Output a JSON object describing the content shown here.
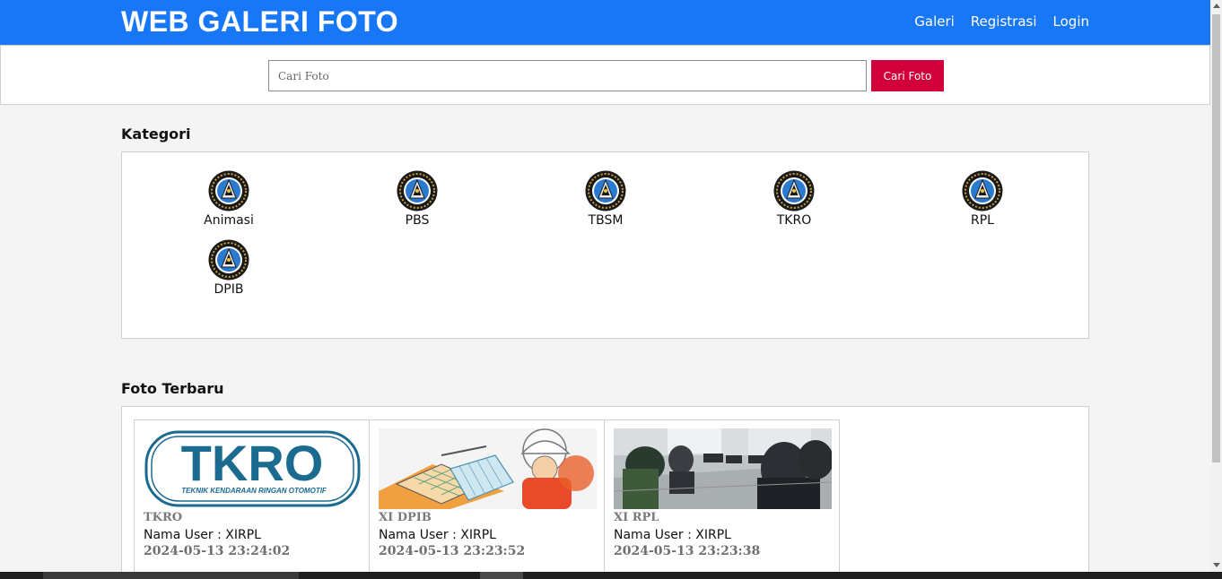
{
  "header": {
    "brand": "WEB GALERI FOTO",
    "nav": [
      "Galeri",
      "Registrasi",
      "Login"
    ],
    "brand_color": "#1877f7"
  },
  "search": {
    "placeholder": "Cari Foto",
    "value": "",
    "button_label": "Cari Foto",
    "button_color": "#d1003a"
  },
  "kategori": {
    "title": "Kategori",
    "items": [
      {
        "label": "Animasi",
        "icon": "school-logo-icon"
      },
      {
        "label": "PBS",
        "icon": "school-logo-icon"
      },
      {
        "label": "TBSM",
        "icon": "school-logo-icon"
      },
      {
        "label": "TKRO",
        "icon": "school-logo-icon"
      },
      {
        "label": "RPL",
        "icon": "school-logo-icon"
      },
      {
        "label": "DPIB",
        "icon": "school-logo-icon"
      }
    ]
  },
  "foto_terbaru": {
    "title": "Foto Terbaru",
    "cards": [
      {
        "title": "TKRO",
        "user": "Nama User : XIRPL",
        "date": "2024-05-13 23:24:02",
        "thumb_text": "TKRO",
        "thumb_subtext": "TEKNIK KENDARAAN RINGAN OTOMOTIF"
      },
      {
        "title": "XI DPIB",
        "user": "Nama User : XIRPL",
        "date": "2024-05-13 23:23:52"
      },
      {
        "title": "XI RPL",
        "user": "Nama User : XIRPL",
        "date": "2024-05-13 23:23:38"
      }
    ]
  }
}
